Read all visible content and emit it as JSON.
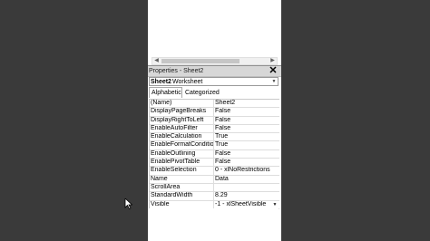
{
  "window": {
    "title": "Properties - Sheet2"
  },
  "object_selector": {
    "name": "Sheet2",
    "type": "Worksheet"
  },
  "tabs": [
    {
      "label": "Alphabetic"
    },
    {
      "label": "Categorized"
    }
  ],
  "properties": [
    {
      "key": "(Name)",
      "value": "Sheet2"
    },
    {
      "key": "DisplayPageBreaks",
      "value": "False"
    },
    {
      "key": "DisplayRightToLeft",
      "value": "False"
    },
    {
      "key": "EnableAutoFilter",
      "value": "False"
    },
    {
      "key": "EnableCalculation",
      "value": "True"
    },
    {
      "key": "EnableFormatConditions",
      "value": "True"
    },
    {
      "key": "EnableOutlining",
      "value": "False"
    },
    {
      "key": "EnablePivotTable",
      "value": "False"
    },
    {
      "key": "EnableSelection",
      "value": "0 - xlNoRestrictions"
    },
    {
      "key": "Name",
      "value": "Data"
    },
    {
      "key": "ScrollArea",
      "value": ""
    },
    {
      "key": "StandardWidth",
      "value": "8.29"
    },
    {
      "key": "Visible",
      "value": "-1 - xlSheetVisible"
    }
  ],
  "colors": {
    "panel_bg": "#ffffff",
    "dark_surround": "#3a3a3a",
    "title_bar": "#d7d7d7"
  }
}
